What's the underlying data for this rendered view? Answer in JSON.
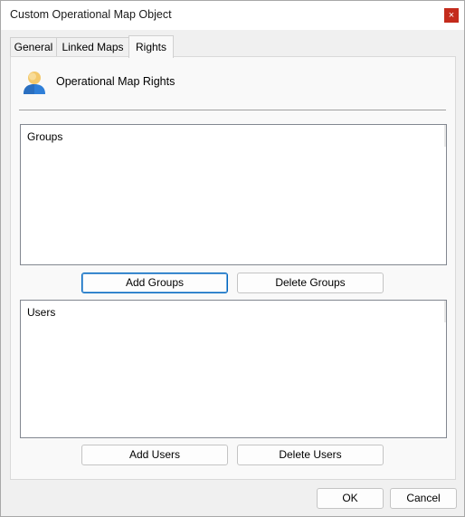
{
  "window": {
    "title": "Custom Operational Map Object",
    "close_glyph": "×"
  },
  "tabs": [
    {
      "label": "General",
      "active": false
    },
    {
      "label": "Linked Maps",
      "active": false
    },
    {
      "label": "Rights",
      "active": true
    }
  ],
  "rights": {
    "heading": "Operational Map Rights",
    "heading_icon": "user-icon",
    "groups": {
      "header": "Groups",
      "items": [],
      "add_label": "Add Groups",
      "delete_label": "Delete Groups"
    },
    "users": {
      "header": "Users",
      "items": [],
      "add_label": "Add Users",
      "delete_label": "Delete Users"
    }
  },
  "footer": {
    "ok_label": "OK",
    "cancel_label": "Cancel"
  },
  "colors": {
    "accent": "#0067c0",
    "close_button": "#c42b1c",
    "user_icon_head": "#f3c86b",
    "user_icon_body": "#2f7fd8"
  }
}
